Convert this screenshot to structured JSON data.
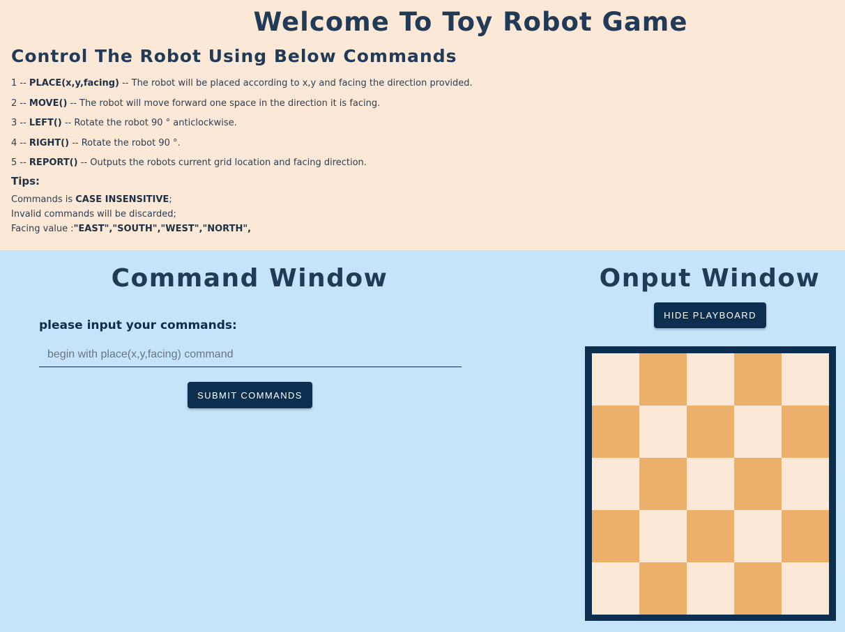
{
  "header": {
    "title": "Welcome To Toy Robot Game",
    "subtitle": "Control The Robot Using Below Commands"
  },
  "commands": [
    {
      "num": "1 -- ",
      "name": "PLACE(x,y,facing)",
      "desc": " -- The robot will be placed according to x,y and facing the direction provided."
    },
    {
      "num": "2 -- ",
      "name": "MOVE()",
      "desc": " -- The robot will move forward one space in the direction it is facing."
    },
    {
      "num": "3 -- ",
      "name": "LEFT()",
      "desc": " -- Rotate the robot 90 ° anticlockwise."
    },
    {
      "num": "4 -- ",
      "name": "RIGHT()",
      "desc": " -- Rotate the robot 90 °."
    },
    {
      "num": "5 -- ",
      "name": "REPORT()",
      "desc": " -- Outputs the robots current grid location and facing direction."
    }
  ],
  "tips": {
    "title": "Tips:",
    "line1_prefix": "Commands is ",
    "line1_bold": "CASE INSENSITIVE",
    "line1_suffix": ";",
    "line2": "Invalid commands will be discarded;",
    "line3_prefix": "Facing value :",
    "line3_bold": "\"EAST\",\"SOUTH\",\"WEST\",\"NORTH\","
  },
  "command_window": {
    "title": "Command Window",
    "input_label": "please input your commands:",
    "input_placeholder": "begin with place(x,y,facing) command",
    "input_value": "",
    "submit_label": "SUBMIT COMMANDS"
  },
  "output_window": {
    "title": "Onput Window",
    "hide_label": "HIDE PLAYBOARD",
    "board_size": 5
  },
  "colors": {
    "top_bg": "#fbe8d6",
    "bottom_bg": "#c5e4fa",
    "button_bg": "#0c2f4f",
    "board_border": "#0c2f4f",
    "cell_light": "#fbe8d6",
    "cell_dark": "#edb06b"
  }
}
